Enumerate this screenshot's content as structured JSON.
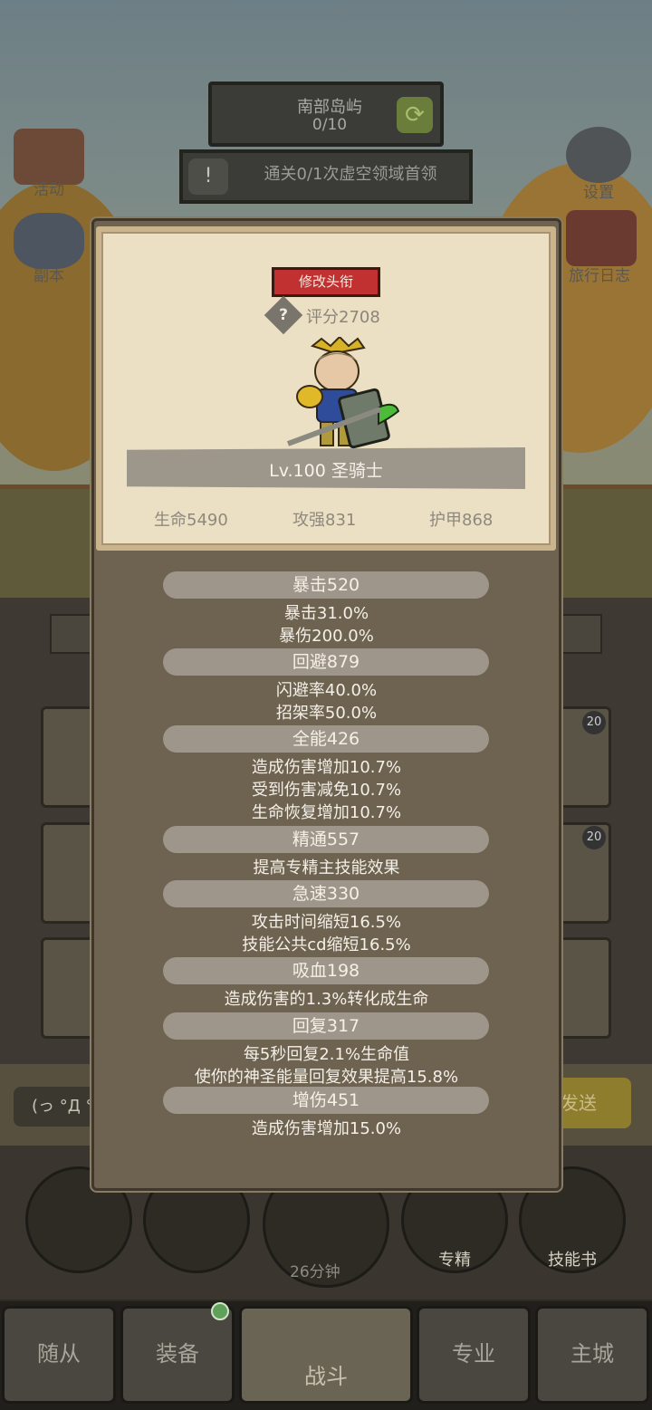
{
  "hud": {
    "zone_name": "南部岛屿",
    "zone_progress": "0/10",
    "quest_text": "通关0/1次虚空领域首领",
    "left_icons": [
      "活动",
      "副本"
    ],
    "right_icons": [
      "设置",
      "旅行日志"
    ]
  },
  "background": {
    "item_levels": [
      "20",
      "20"
    ],
    "chat_placeholder": "(っ °Д °",
    "send_label": "发送",
    "dock_labels": [
      "专精",
      "技能书"
    ],
    "timer": "26分钟",
    "tabs": [
      "随从",
      "装备",
      "战斗",
      "专业",
      "主城"
    ]
  },
  "modal": {
    "title_button": "修改头衔",
    "score": "评分2708",
    "level": "Lv.100 圣骑士",
    "base_stats": [
      "生命5490",
      "攻强831",
      "护甲868"
    ],
    "stats": [
      {
        "head": "暴击520",
        "lines": [
          "暴击31.0%",
          "暴伤200.0%"
        ]
      },
      {
        "head": "回避879",
        "lines": [
          "闪避率40.0%",
          "招架率50.0%"
        ]
      },
      {
        "head": "全能426",
        "lines": [
          "造成伤害增加10.7%",
          "受到伤害减免10.7%",
          "生命恢复增加10.7%"
        ]
      },
      {
        "head": "精通557",
        "lines": [
          "提高专精主技能效果"
        ]
      },
      {
        "head": "急速330",
        "lines": [
          "攻击时间缩短16.5%",
          "技能公共cd缩短16.5%"
        ]
      },
      {
        "head": "吸血198",
        "lines": [
          "造成伤害的1.3%转化成生命"
        ]
      },
      {
        "head": "回复317",
        "lines": [
          "每5秒回复2.1%生命值",
          "使你的神圣能量回复效果提高15.8%"
        ]
      },
      {
        "head": "增伤451",
        "lines": [
          "造成伤害增加15.0%"
        ]
      }
    ]
  }
}
